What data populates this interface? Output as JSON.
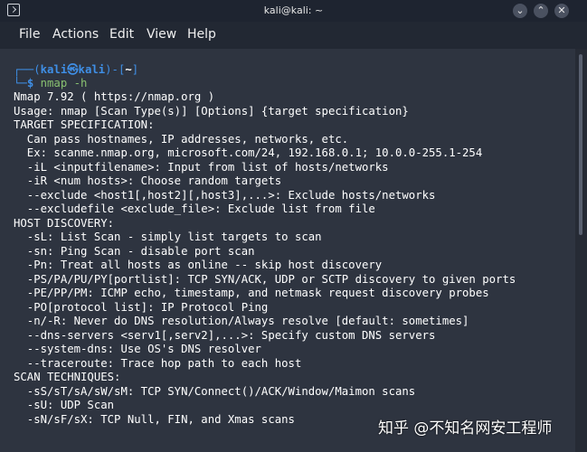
{
  "window": {
    "title": "kali@kali: ~",
    "controls": {
      "minimize": "⌄",
      "maximize": "⌃",
      "close": "✕"
    }
  },
  "menu": {
    "items": [
      "File",
      "Actions",
      "Edit",
      "View",
      "Help"
    ]
  },
  "prompt": {
    "user_host": "kali㉿kali",
    "path": "~",
    "command": "nmap -h"
  },
  "output": [
    "Nmap 7.92 ( https://nmap.org )",
    "Usage: nmap [Scan Type(s)] [Options] {target specification}",
    "TARGET SPECIFICATION:",
    "  Can pass hostnames, IP addresses, networks, etc.",
    "  Ex: scanme.nmap.org, microsoft.com/24, 192.168.0.1; 10.0.0-255.1-254",
    "  -iL <inputfilename>: Input from list of hosts/networks",
    "  -iR <num hosts>: Choose random targets",
    "  --exclude <host1[,host2][,host3],...>: Exclude hosts/networks",
    "  --excludefile <exclude_file>: Exclude list from file",
    "HOST DISCOVERY:",
    "  -sL: List Scan - simply list targets to scan",
    "  -sn: Ping Scan - disable port scan",
    "  -Pn: Treat all hosts as online -- skip host discovery",
    "  -PS/PA/PU/PY[portlist]: TCP SYN/ACK, UDP or SCTP discovery to given ports",
    "  -PE/PP/PM: ICMP echo, timestamp, and netmask request discovery probes",
    "  -PO[protocol list]: IP Protocol Ping",
    "  -n/-R: Never do DNS resolution/Always resolve [default: sometimes]",
    "  --dns-servers <serv1[,serv2],...>: Specify custom DNS servers",
    "  --system-dns: Use OS's DNS resolver",
    "  --traceroute: Trace hop path to each host",
    "SCAN TECHNIQUES:",
    "  -sS/sT/sA/sW/sM: TCP SYN/Connect()/ACK/Window/Maimon scans",
    "  -sU: UDP Scan",
    "  -sN/sF/sX: TCP Null, FIN, and Xmas scans"
  ],
  "watermark": "知乎 @不知名网安工程师"
}
